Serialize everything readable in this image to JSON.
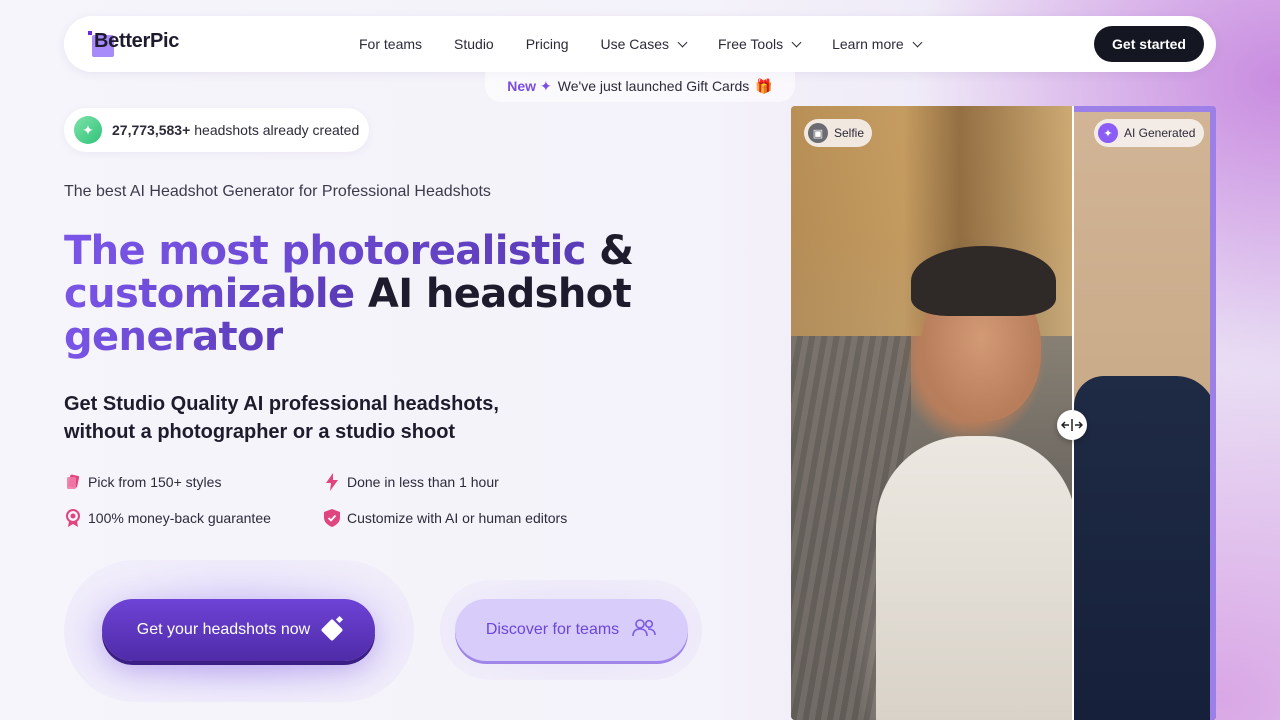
{
  "nav": {
    "logo": "BetterPic",
    "links": [
      "For teams",
      "Studio",
      "Pricing",
      "Use Cases",
      "Free Tools",
      "Learn more"
    ],
    "cta": "Get started"
  },
  "announcement": {
    "badge": "New",
    "text": "We've just launched Gift Cards",
    "icons": [
      "sparkle-icon",
      "gift-icon"
    ]
  },
  "stats": {
    "count": "27,773,583+",
    "text": "headshots already created"
  },
  "hero": {
    "tagline": "The best AI Headshot Generator for Professional Headshots",
    "headline_line1_accent": "The most photorealistic",
    "headline_line1_rest": " &",
    "headline_line2_accent": "customizable",
    "headline_line2_rest": " AI headshot",
    "headline_line3": "generator",
    "subhead_line1": "Get Studio Quality AI professional headshots,",
    "subhead_line2": "without a photographer or a studio shoot"
  },
  "features": [
    {
      "icon": "styles-icon",
      "label": "Pick from 150+ styles"
    },
    {
      "icon": "bolt-icon",
      "label": "Done in less than 1 hour"
    },
    {
      "icon": "guarantee-badge-icon",
      "label": "100% money-back guarantee"
    },
    {
      "icon": "shield-check-icon",
      "label": "Customize with AI or human editors"
    }
  ],
  "buttons": {
    "primary": "Get your headshots now",
    "secondary": "Discover for teams"
  },
  "comparison": {
    "left_label": "Selfie",
    "right_label": "AI Generated"
  },
  "colors": {
    "accent": "#7c4de0",
    "primary_button": "#5a34bd",
    "secondary_button": "#d8ccfb",
    "dark_cta": "#141622"
  }
}
